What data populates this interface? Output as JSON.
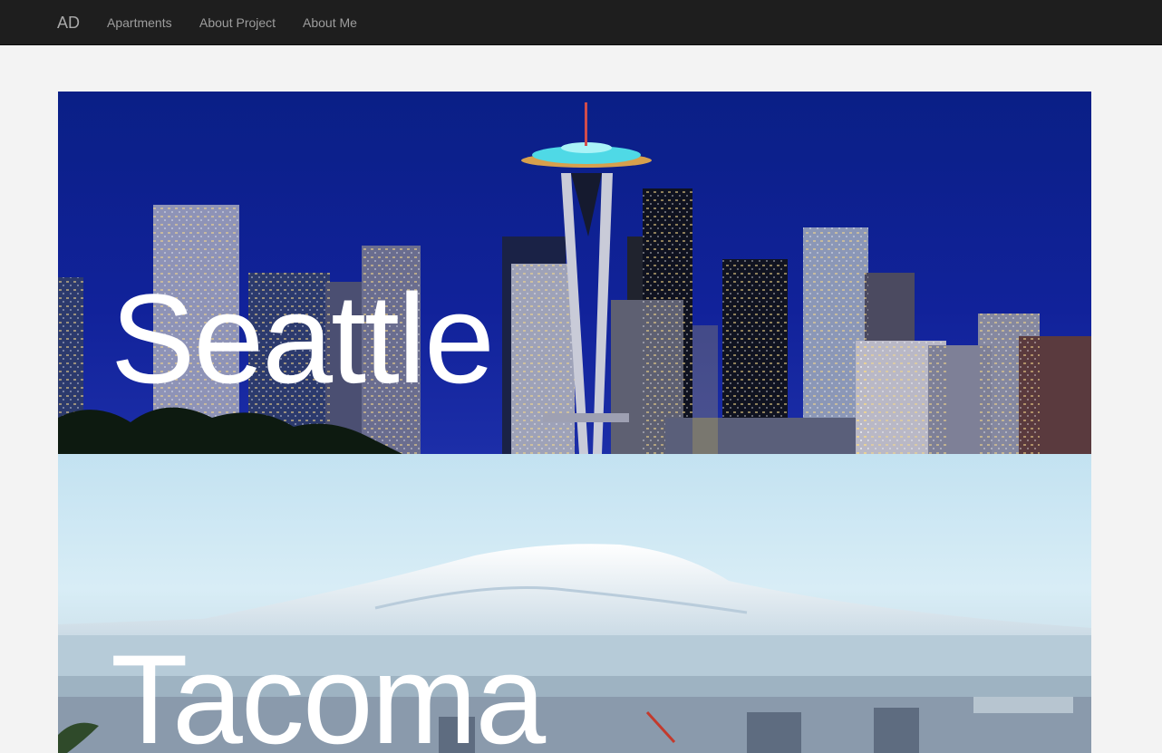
{
  "navbar": {
    "brand": "AD",
    "links": [
      {
        "label": "Apartments"
      },
      {
        "label": "About Project"
      },
      {
        "label": "About Me"
      }
    ]
  },
  "cities": [
    {
      "name": "Seattle"
    },
    {
      "name": "Tacoma"
    }
  ]
}
